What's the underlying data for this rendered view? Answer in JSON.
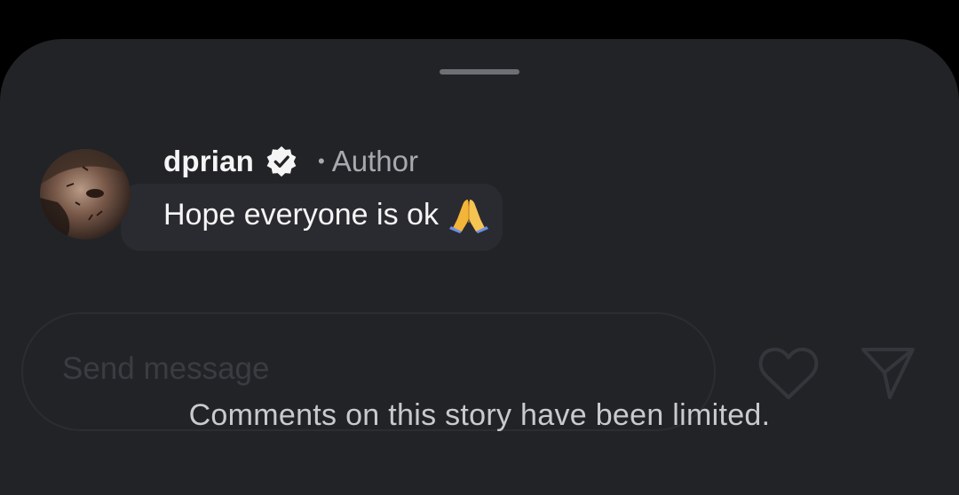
{
  "comment": {
    "username": "dprian",
    "verified": true,
    "separator": "•",
    "role_label": "Author",
    "text": "Hope everyone is ok",
    "emoji": "folded-hands"
  },
  "composer": {
    "placeholder": "Send message"
  },
  "notice": {
    "text": "Comments on this story have been limited."
  },
  "icons": {
    "like": "heart-icon",
    "share": "paper-plane-icon",
    "verified": "verified-badge-icon"
  },
  "colors": {
    "sheet_background": "#222327",
    "text_primary": "#f5f5f5",
    "text_secondary": "#a8a9ae",
    "notice_text": "#c9cacd"
  }
}
